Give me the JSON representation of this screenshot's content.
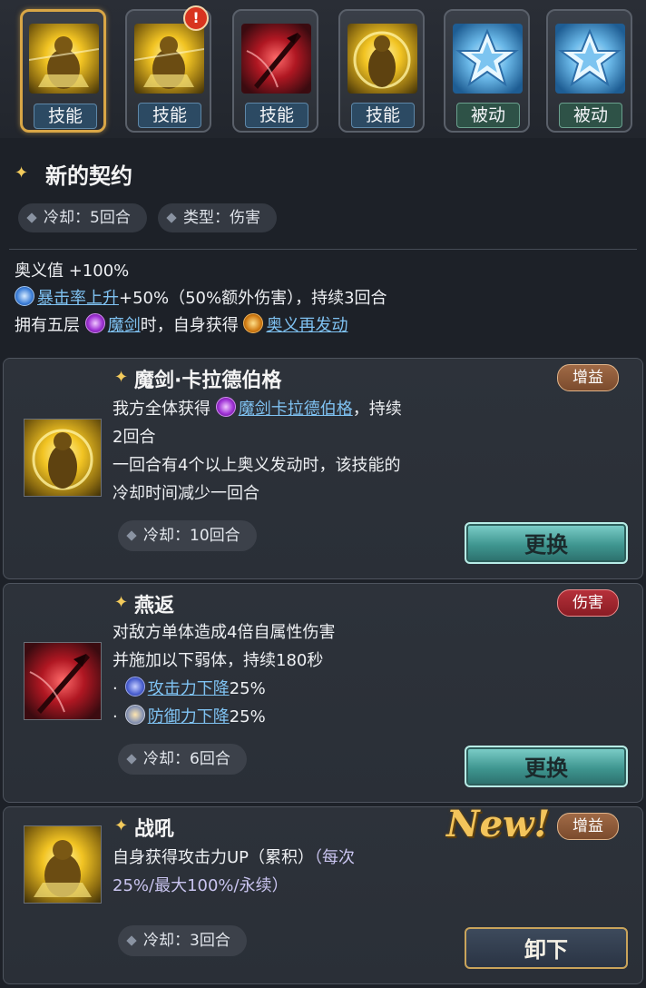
{
  "tabs": [
    {
      "label": "技能",
      "type": "skill",
      "art": "golden-knight",
      "active": true,
      "alert": false
    },
    {
      "label": "技能",
      "type": "skill",
      "art": "golden-knight",
      "active": false,
      "alert": true
    },
    {
      "label": "技能",
      "type": "skill",
      "art": "crimson-sword",
      "active": false,
      "alert": false
    },
    {
      "label": "技能",
      "type": "skill",
      "art": "golden-aura-knight",
      "active": false,
      "alert": false
    },
    {
      "label": "被动",
      "type": "passive",
      "art": "blue-star",
      "active": false,
      "alert": false
    },
    {
      "label": "被动",
      "type": "passive",
      "art": "blue-star",
      "active": false,
      "alert": false
    }
  ],
  "alert_mark": "!",
  "skill": {
    "name": "新的契约",
    "cooldown": "冷却：5回合",
    "type": "类型：伤害",
    "line1": "奥义值 +100%",
    "line2_link": "暴击率上升",
    "line2_rest": "+50%（50%额外伤害），持续3回合",
    "line3_a": "拥有五层 ",
    "line3_link1": "魔剑",
    "line3_b": "时，自身获得 ",
    "line3_link2": "奥义再发动"
  },
  "cards": [
    {
      "title": "魔剑·卡拉德伯格",
      "tag": "增益",
      "line1_a": "我方全体获得 ",
      "line1_link": "魔剑卡拉德伯格",
      "line1_b": "，持续",
      "line2": "2回合",
      "line3": "一回合有4个以上奥义发动时，该技能的",
      "line4": "冷却时间减少一回合",
      "cooldown": "冷却：10回合",
      "button": "更换"
    },
    {
      "title": "燕返",
      "tag": "伤害",
      "line1": "对敌方单体造成4倍自属性伤害",
      "line2": "并施加以下弱体，持续180秒",
      "bullet": "·",
      "debuff1_link": "攻击力下降",
      "debuff1_val": "25%",
      "debuff2_link": "防御力下降",
      "debuff2_val": "25%",
      "cooldown": "冷却：6回合",
      "button": "更换"
    },
    {
      "title": "战吼",
      "tag": "增益",
      "new_label": "New!",
      "line1_a": "自身获得攻击力UP（累积）",
      "line1_b": "（每次",
      "line2": "25%/最大100%/永续）",
      "cooldown": "冷却：3回合",
      "button": "卸下"
    }
  ],
  "sparkle": "✦",
  "colors": {
    "accent_gold": "#d9a646",
    "link_blue": "#7fc2f2",
    "tag_buff": "#8f5a38",
    "tag_damage": "#a2262f",
    "button_teal": "#4fa7a0"
  }
}
